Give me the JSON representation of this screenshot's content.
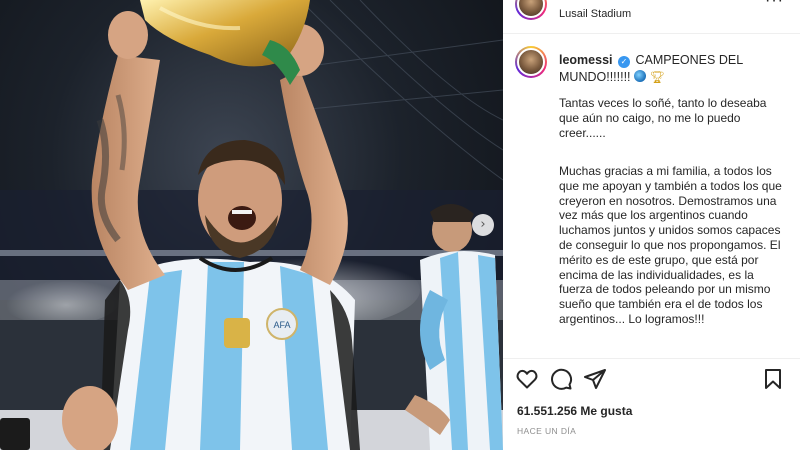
{
  "post": {
    "location": "Lusail Stadium",
    "username": "leomessi",
    "caption_title": "CAMPEONES DEL MUNDO!!!!!!!",
    "paragraph1": "Tantas veces lo soñé, tanto lo deseaba que aún no caigo, no me lo puedo creer......",
    "paragraph2": "Muchas gracias a mi familia, a todos los que me apoyan y también a todos los que creyeron en nosotros. Demostramos una vez más que los argentinos cuando luchamos juntos y unidos somos capaces de conseguir lo que nos propongamos. El mérito es de este grupo, que está por encima de las individualidades, es la fuerza de todos peleando por un mismo sueño que también era el de todos los argentinos... Lo logramos!!!",
    "likes": "61.551.256 Me gusta",
    "timestamp": "HACE UN DÍA"
  },
  "icons": {
    "more": "more-options-icon",
    "verified": "verified-badge-icon",
    "like": "heart-icon",
    "comment": "comment-icon",
    "share": "paper-plane-icon",
    "save": "bookmark-icon",
    "next": "chevron-right-icon"
  },
  "colors": {
    "jersey_blue": "#7ec3ea",
    "verified": "#3897f0",
    "trophy_gold": "#d4a017",
    "text": "#262626",
    "muted": "#8e8e8e"
  }
}
